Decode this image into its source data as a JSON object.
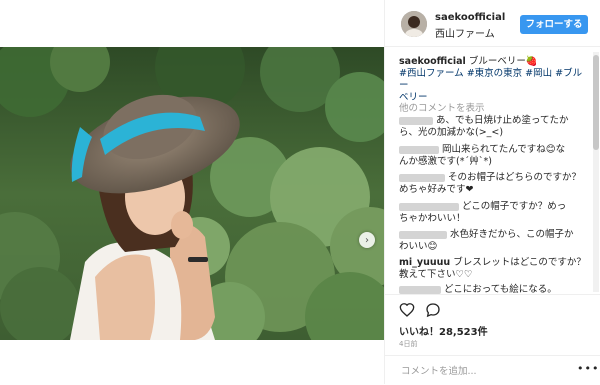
{
  "header": {
    "username": "saekoofficial",
    "location": "西山ファーム",
    "follow_label": "フォローする"
  },
  "caption": {
    "username": "saekoofficial",
    "text": "ブルーベリー🍓",
    "tags_line1": "#西山ファーム #東京の東京 #岡山 #ブルー",
    "tags_line2": "ベリー"
  },
  "load_more": "他のコメントを表示",
  "comments": [
    {
      "user": "xxxxxxx",
      "line1": "あ、でも日焼け止め塗ってたか",
      "line2": "ら、光の加減かな(>_<)"
    },
    {
      "user": "xxxxxxxx",
      "line1": "岡山来られてたんですね😊な",
      "line2": "んか感激です(*´艸`*)"
    },
    {
      "user": "xxxxxxxxxx",
      "line1": "そのお帽子はどちらのですか？",
      "line2": "めちゃ好みです❤"
    },
    {
      "user": "xxxxxxxxxxxx",
      "line1": "どこの帽子ですか？めっ",
      "line2": "ちゃかわいい！"
    },
    {
      "user": "xxxxxxxxxx",
      "line1": "水色好きだから、この帽子か",
      "line2": "わいい😊"
    },
    {
      "user": "mi_yuuuu",
      "line1": "ブレスレットはどこのですか？",
      "line2": "教えて下さい♡♡"
    },
    {
      "user": "xxxxxxxxx",
      "line1": "どこにおっても絵になる。",
      "line2": ""
    }
  ],
  "actions": {
    "likes_label": "いいね！",
    "likes_count": "28,523件",
    "time": "4日前",
    "comment_placeholder": "コメントを追加...",
    "more_dots": "•••"
  },
  "colors": {
    "accent": "#3897f0",
    "hashtag": "#003569",
    "hat_ribbon": "#2bb3d6"
  }
}
